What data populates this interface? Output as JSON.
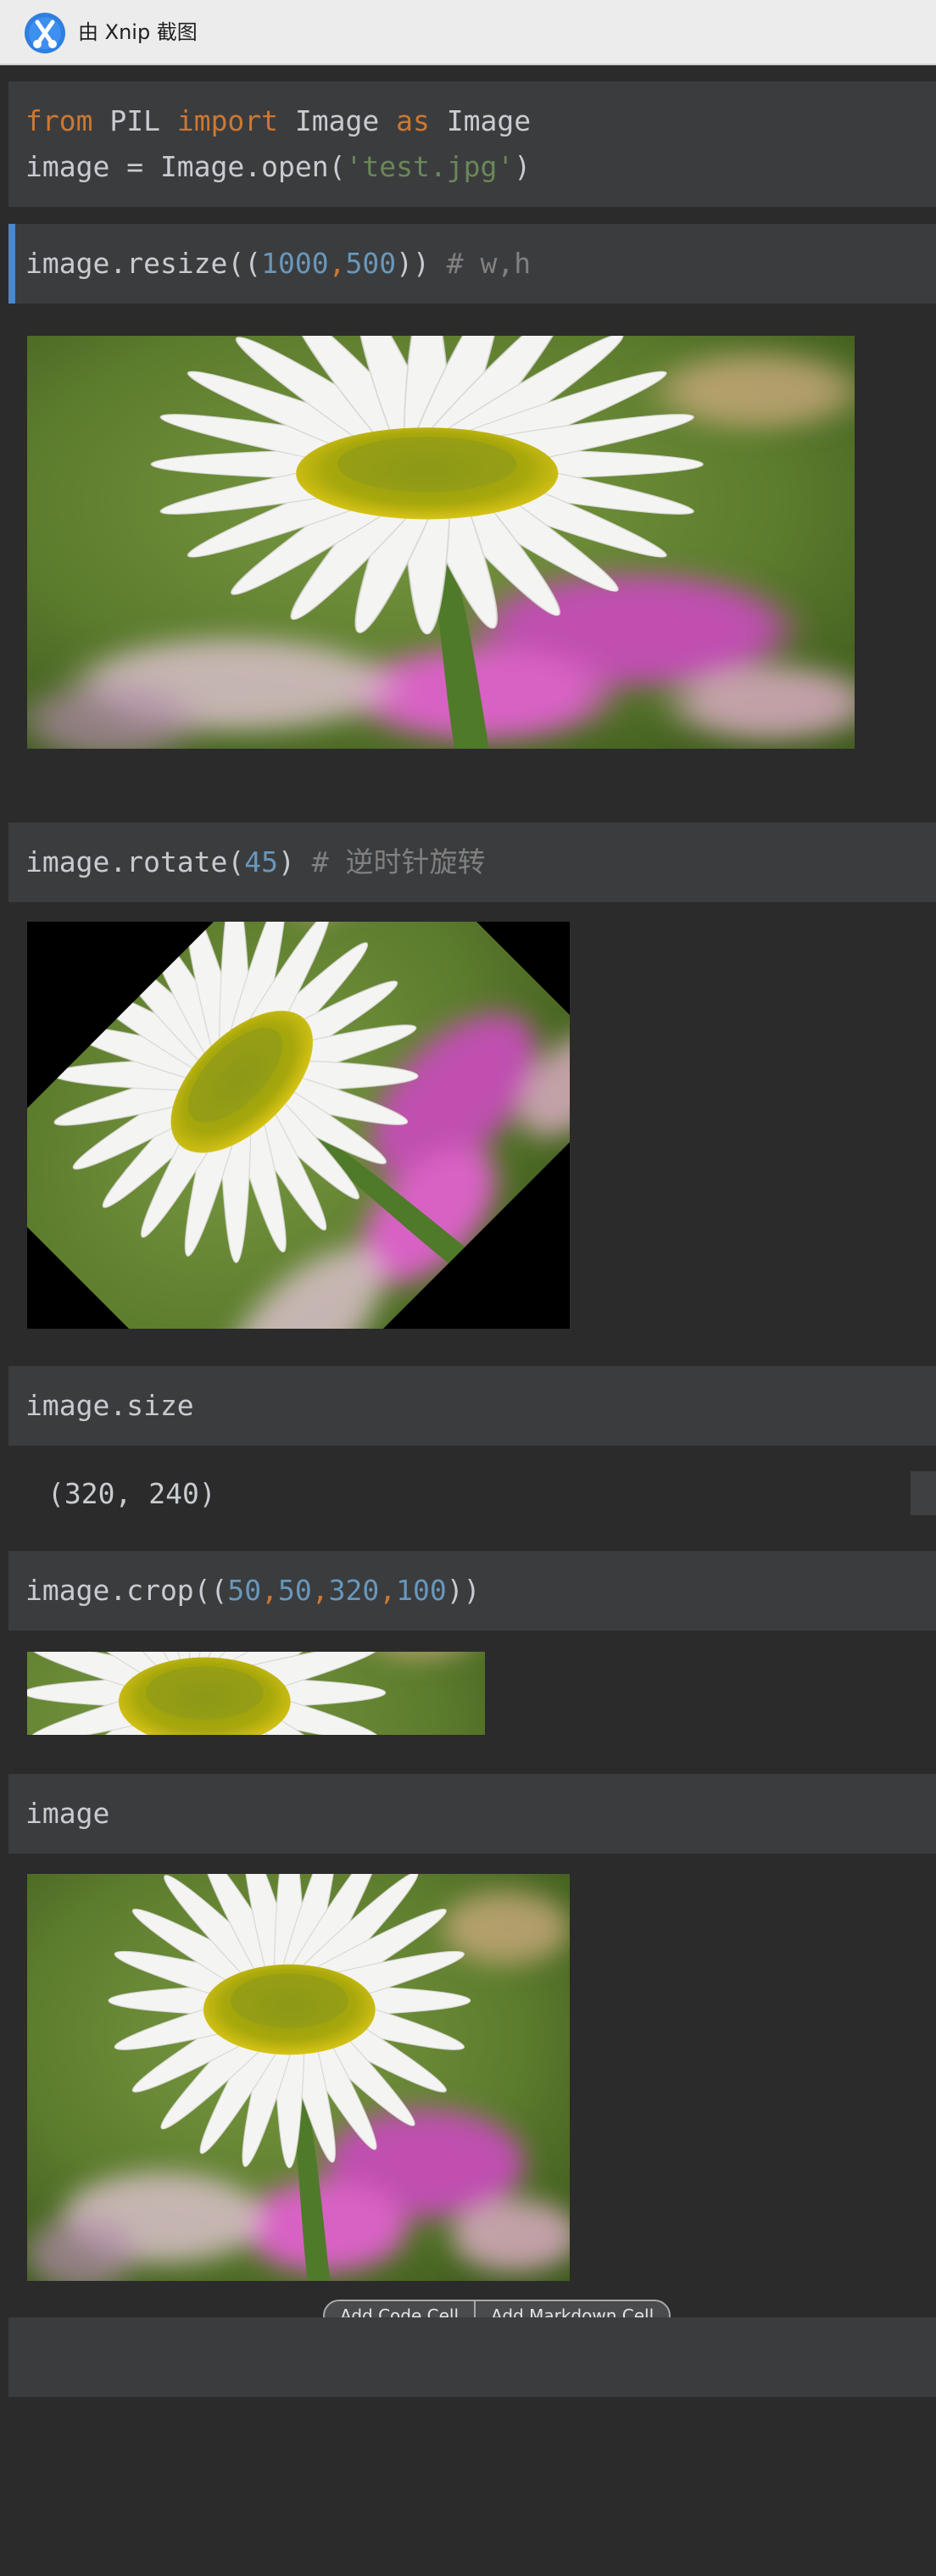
{
  "titlebar": {
    "title": "由 Xnip 截图",
    "logo_icon": "xnip-logo-icon"
  },
  "cells": {
    "c1": {
      "l1_from": "from",
      "l1_pil": " PIL ",
      "l1_import": "import",
      "l1_image": " Image ",
      "l1_as": "as",
      "l1_image2": " Image",
      "l2_pre": "image = Image.open(",
      "l2_str": "'test.jpg'",
      "l2_post": ")"
    },
    "c2": {
      "pre": "image.resize((",
      "n1": "1000",
      "comma": ",",
      "n2": "500",
      "post": ")) ",
      "comment": "# w,h"
    },
    "c3": {
      "pre": "image.rotate(",
      "n1": "45",
      "post": ") ",
      "comment": "# 逆时针旋转"
    },
    "c4": {
      "code": "image.size",
      "output": "(320, 240)"
    },
    "c5": {
      "pre": "image.crop((",
      "n1": "50",
      "n2": "50",
      "n3": "320",
      "n4": "100",
      "comma": ",",
      "post": "))"
    },
    "c6": {
      "code": "image"
    }
  },
  "add_bar": {
    "code_label": "Add Code Cell",
    "markdown_label": "Add Markdown Cell"
  },
  "colors": {
    "background": "#2b2b2b",
    "cell_bg": "#3b3c3e",
    "keyword": "#cc7832",
    "string": "#6a8759",
    "number": "#6897bb",
    "comment": "#808080",
    "active_bar": "#4b87cc"
  }
}
